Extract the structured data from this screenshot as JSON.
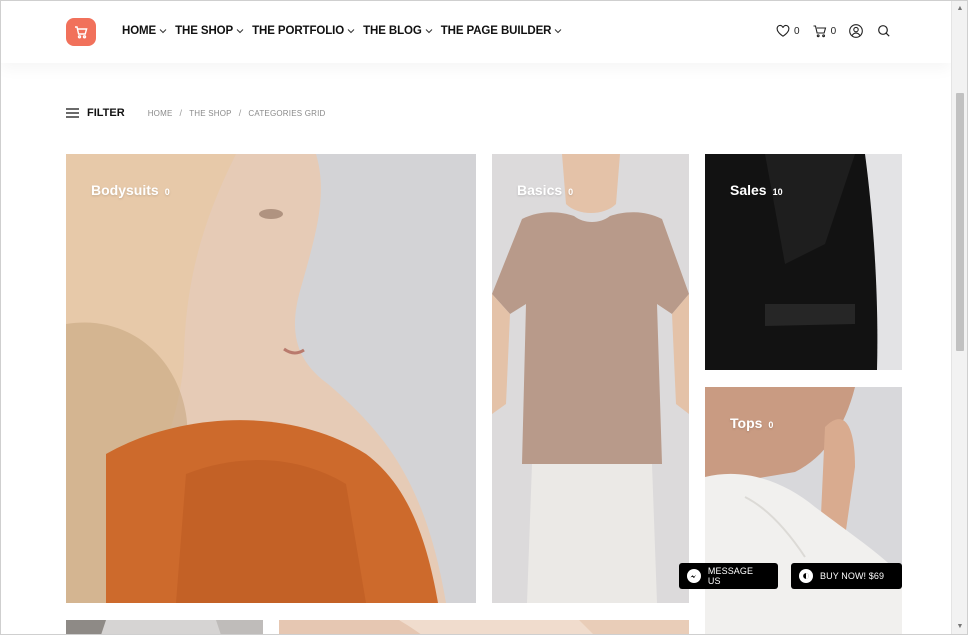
{
  "header": {
    "logo_icon": "cart-icon",
    "brand_color": "#f1715b",
    "nav": [
      {
        "label": "HOME"
      },
      {
        "label": "THE SHOP"
      },
      {
        "label": "THE PORTFOLIO"
      },
      {
        "label": "THE BLOG"
      },
      {
        "label": "THE PAGE BUILDER"
      }
    ],
    "wishlist_count": "0",
    "cart_count": "0"
  },
  "filterbar": {
    "filter_label": "FILTER",
    "breadcrumb": [
      "HOME",
      "THE SHOP",
      "CATEGORIES GRID"
    ],
    "separator": "/"
  },
  "categories": [
    {
      "name": "Bodysuits",
      "count": "0"
    },
    {
      "name": "Basics",
      "count": "0"
    },
    {
      "name": "Sales",
      "count": "10"
    },
    {
      "name": "Tops",
      "count": "0"
    }
  ],
  "floating": {
    "message_label": "MESSAGE US",
    "buy_label": "BUY NOW! $69"
  }
}
